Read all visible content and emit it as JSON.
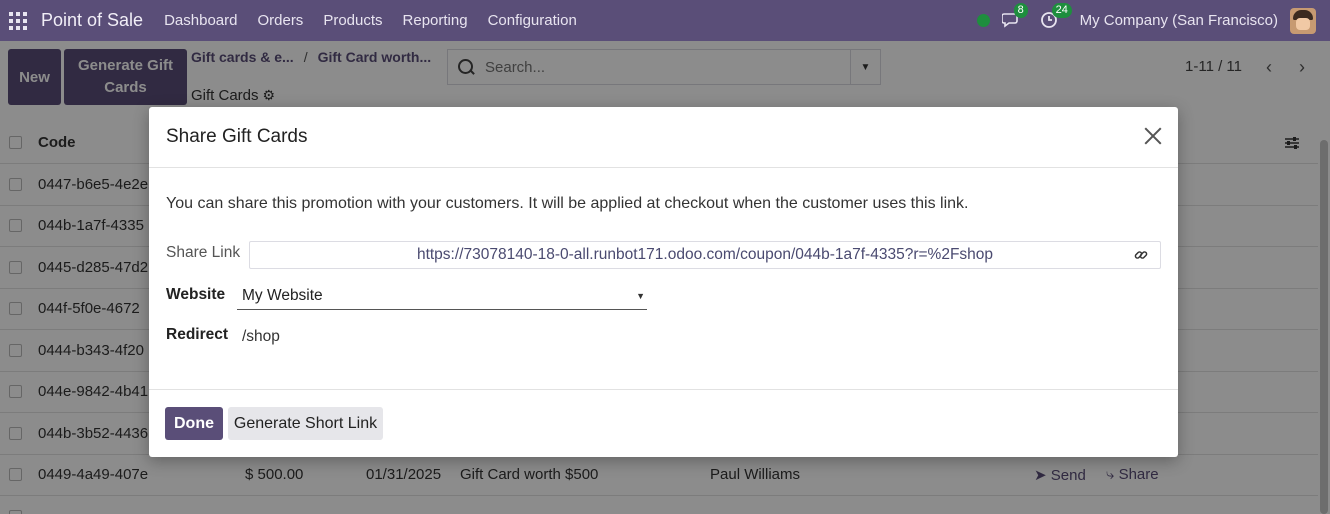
{
  "navbar": {
    "brand": "Point of Sale",
    "menu": [
      "Dashboard",
      "Orders",
      "Products",
      "Reporting",
      "Configuration"
    ],
    "messages_count": "8",
    "activities_count": "24",
    "company": "My Company (San Francisco)"
  },
  "control_panel": {
    "new_label": "New",
    "generate_label": "Generate Gift Cards",
    "breadcrumb_1": "Gift cards & e...",
    "breadcrumb_2": "Gift Card worth...",
    "subtitle": "Gift Cards",
    "search_placeholder": "Search...",
    "pager": "1-11 / 11"
  },
  "list": {
    "header_code": "Code",
    "codes": [
      "0447-b6e5-4e2e",
      "044b-1a7f-4335",
      "0445-d285-47d2",
      "044f-5f0e-4672",
      "0444-b343-4f20",
      "044e-9842-4b41",
      "044b-3b52-4436"
    ],
    "visible_row": {
      "code": "0449-4a49-407e",
      "amount": "$ 500.00",
      "date": "01/31/2025",
      "program": "Gift Card worth $500",
      "partner": "Paul Williams",
      "send": "Send",
      "share": "Share"
    }
  },
  "modal": {
    "title": "Share Gift Cards",
    "intro": "You can share this promotion with your customers. It will be applied at checkout when the customer uses this link.",
    "share_link_label": "Share Link",
    "share_link_value": "https://73078140-18-0-all.runbot171.odoo.com/coupon/044b-1a7f-4335?r=%2Fshop",
    "website_label": "Website",
    "website_value": "My Website",
    "redirect_label": "Redirect",
    "redirect_value": "/shop",
    "done_label": "Done",
    "short_link_label": "Generate Short Link"
  },
  "colors": {
    "brand": "#5a4e78",
    "presence": "#1e8e3e"
  }
}
